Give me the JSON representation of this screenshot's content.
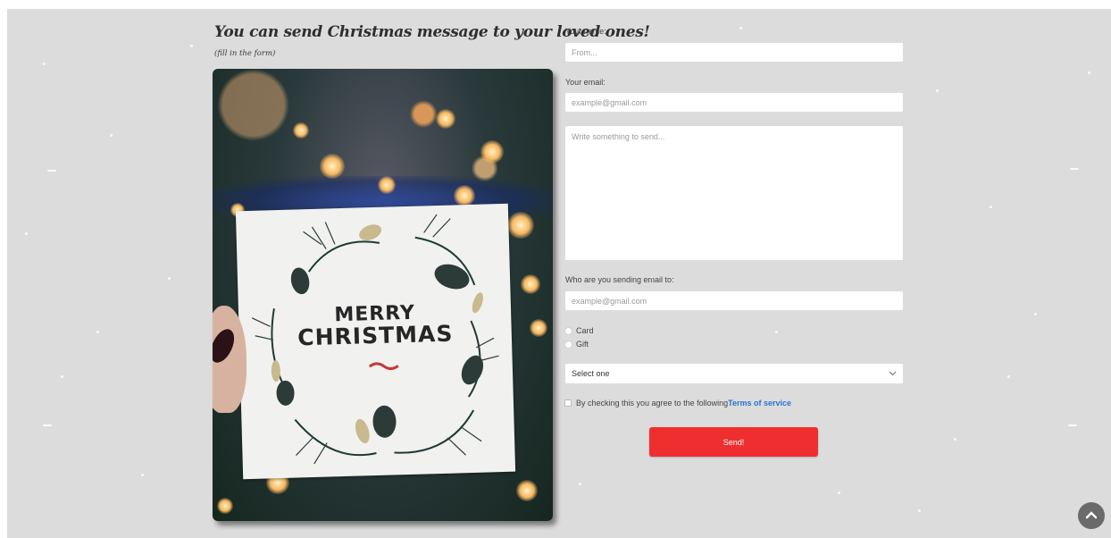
{
  "headline": "You can send Christmas message to your loved ones!",
  "subheadline": "(fill in the form)",
  "photo": {
    "card_line1": "MERRY",
    "card_line2": "CHRISTMAS"
  },
  "form": {
    "name_label": "Your name:",
    "name_placeholder": "From...",
    "email_label": "Your email:",
    "email_placeholder": "example@gmail.com",
    "message_placeholder": "Write something to send...",
    "recipient_label": "Who are you sending email to:",
    "recipient_placeholder": "example@gmail.com",
    "options": [
      "Card",
      "Gift"
    ],
    "select_value": "Select one",
    "terms_text": "By checking this you agree to the following",
    "terms_link": "Terms of service",
    "send_label": "Send!"
  },
  "icons": {
    "scroll_top": "chevron-up-icon",
    "select_arrow": "chevron-down-icon"
  },
  "colors": {
    "background": "#dcdcdc",
    "send_button": "#ef2f2f",
    "link": "#2a72d6"
  }
}
